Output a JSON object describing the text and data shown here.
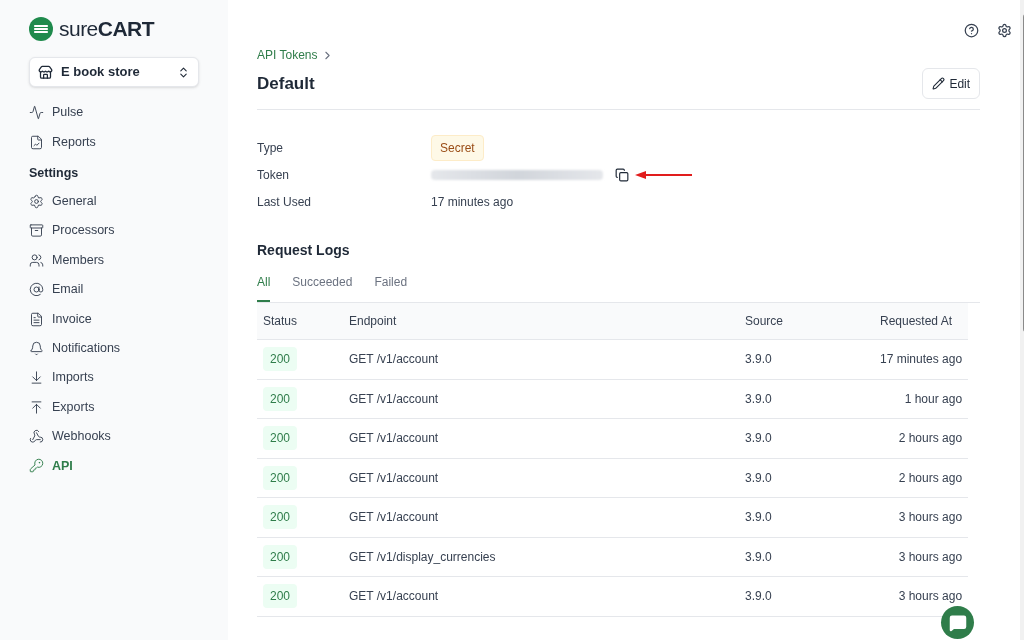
{
  "brand": {
    "name_light": "sure",
    "name_bold": "CART"
  },
  "store_switcher": {
    "value": "E book store"
  },
  "sidebar": {
    "items": [
      {
        "label": "Pulse",
        "selected": false
      },
      {
        "label": "Reports",
        "selected": false
      }
    ],
    "section": "Settings",
    "settings_items": [
      {
        "label": "General",
        "selected": false
      },
      {
        "label": "Processors",
        "selected": false
      },
      {
        "label": "Members",
        "selected": false
      },
      {
        "label": "Email",
        "selected": false
      },
      {
        "label": "Invoice",
        "selected": false
      },
      {
        "label": "Notifications",
        "selected": false
      },
      {
        "label": "Imports",
        "selected": false
      },
      {
        "label": "Exports",
        "selected": false
      },
      {
        "label": "Webhooks",
        "selected": false
      },
      {
        "label": "API",
        "selected": true
      }
    ]
  },
  "breadcrumb": "API Tokens",
  "title": "Default",
  "edit_button": "Edit",
  "details": [
    {
      "label": "Type",
      "kind": "badge",
      "value": "Secret"
    },
    {
      "label": "Token",
      "kind": "secret"
    },
    {
      "label": "Last Used",
      "kind": "text",
      "value": "17 minutes ago"
    }
  ],
  "request_logs": {
    "title": "Request Logs",
    "tabs": [
      {
        "label": "All",
        "selected": true
      },
      {
        "label": "Succeeded",
        "selected": false
      },
      {
        "label": "Failed",
        "selected": false
      }
    ],
    "columns": [
      "Status",
      "Endpoint",
      "Source",
      "Requested At"
    ],
    "rows": [
      [
        "200",
        "GET /v1/account",
        "3.9.0",
        "17 minutes ago"
      ],
      [
        "200",
        "GET /v1/account",
        "3.9.0",
        "1 hour ago"
      ],
      [
        "200",
        "GET /v1/account",
        "3.9.0",
        "2 hours ago"
      ],
      [
        "200",
        "GET /v1/account",
        "3.9.0",
        "2 hours ago"
      ],
      [
        "200",
        "GET /v1/account",
        "3.9.0",
        "3 hours ago"
      ],
      [
        "200",
        "GET /v1/display_currencies",
        "3.9.0",
        "3 hours ago"
      ],
      [
        "200",
        "GET /v1/account",
        "3.9.0",
        "3 hours ago"
      ]
    ]
  }
}
